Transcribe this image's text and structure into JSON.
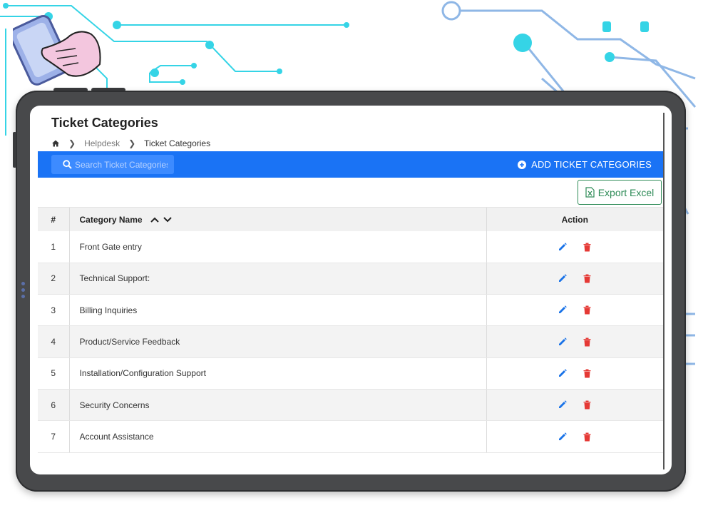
{
  "page": {
    "title": "Ticket Categories",
    "breadcrumb": {
      "home_icon": "home-icon",
      "parent": "Helpdesk",
      "current": "Ticket Categories"
    }
  },
  "toolbar": {
    "search_placeholder": "Search Ticket Categories",
    "add_label": "ADD TICKET CATEGORIES",
    "add_icon": "plus-circle-icon"
  },
  "export": {
    "label": "Export Excel",
    "icon": "excel-icon"
  },
  "table": {
    "headers": {
      "num": "#",
      "name": "Category Name",
      "action": "Action"
    },
    "rows": [
      {
        "num": "1",
        "name": "Front Gate entry"
      },
      {
        "num": "2",
        "name": "Technical Support:"
      },
      {
        "num": "3",
        "name": "Billing Inquiries"
      },
      {
        "num": "4",
        "name": "Product/Service Feedback"
      },
      {
        "num": "5",
        "name": "Installation/Configuration Support"
      },
      {
        "num": "6",
        "name": "Security Concerns"
      },
      {
        "num": "7",
        "name": "Account Assistance"
      }
    ]
  },
  "colors": {
    "toolbar": "#1a73f5",
    "edit": "#1a73e8",
    "delete": "#e53935",
    "export": "#2e8b57",
    "circuit": "#2ad3e8"
  }
}
